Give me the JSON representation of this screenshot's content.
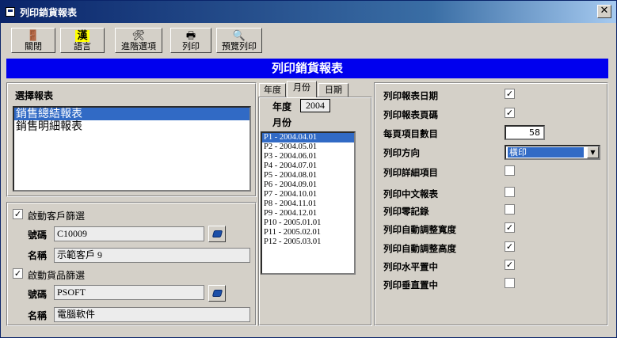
{
  "window": {
    "title": "列印銷貨報表",
    "close_symbol": "✕"
  },
  "toolbar": {
    "close_label": "關閉",
    "language_label": "語言",
    "advanced_label": "進階選項",
    "print_label": "列印",
    "preview_label": "預覽列印"
  },
  "banner": {
    "title": "列印銷貨報表"
  },
  "report_select": {
    "heading": "選擇報表",
    "items": [
      "銷售總結報表",
      "銷售明細報表"
    ],
    "selected_index": 0
  },
  "customer_filter": {
    "checkbox_label": "啟動客戶篩選",
    "checked": true,
    "code_label": "號碼",
    "code_value": "C10009",
    "name_label": "名稱",
    "name_value": "示範客戶 9"
  },
  "product_filter": {
    "checkbox_label": "啟動貨品篩選",
    "checked": true,
    "code_label": "號碼",
    "code_value": "PSOFT",
    "name_label": "名稱",
    "name_value": "電腦軟件"
  },
  "period": {
    "tabs": [
      "年度",
      "月份",
      "日期"
    ],
    "active_tab": "月份",
    "year_label": "年度",
    "year_value": "2004",
    "month_label": "月份",
    "months": [
      "P1 - 2004.04.01",
      "P2 - 2004.05.01",
      "P3 - 2004.06.01",
      "P4 - 2004.07.01",
      "P5 - 2004.08.01",
      "P6 - 2004.09.01",
      "P7 - 2004.10.01",
      "P8 - 2004.11.01",
      "P9 - 2004.12.01",
      "P10 - 2005.01.01",
      "P11 - 2005.02.01",
      "P12 - 2005.03.01"
    ],
    "selected_month_index": 0
  },
  "options": {
    "print_date": {
      "label": "列印報表日期",
      "checked": true
    },
    "print_page_no": {
      "label": "列印報表頁碼",
      "checked": true
    },
    "items_per_page": {
      "label": "每頁項目數目",
      "value": "58"
    },
    "orientation": {
      "label": "列印方向",
      "value": "橫印"
    },
    "print_details": {
      "label": "列印詳細項目",
      "checked": false
    },
    "chinese_report": {
      "label": "列印中文報表",
      "checked": false
    },
    "zero_records": {
      "label": "列印零記錄",
      "checked": false
    },
    "auto_width": {
      "label": "列印自動調整寬度",
      "checked": true
    },
    "auto_height": {
      "label": "列印自動調整高度",
      "checked": true
    },
    "center_horizontal": {
      "label": "列印水平置中",
      "checked": true
    },
    "center_vertical": {
      "label": "列印垂直置中",
      "checked": false
    }
  },
  "check_mark": "✓",
  "colors": {
    "title_bar": "#0a246a",
    "banner": "#0000ee",
    "selection": "#316ac5"
  }
}
